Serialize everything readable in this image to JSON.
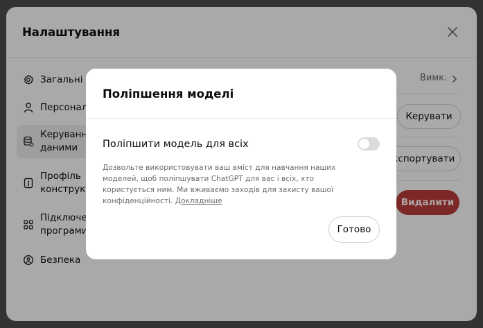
{
  "settings": {
    "title": "Налаштування",
    "nav": [
      {
        "label": "Загальні",
        "icon": "gear-icon"
      },
      {
        "label": "Персоналізація",
        "icon": "person-icon"
      },
      {
        "label": "Керування\nданими",
        "icon": "database-icon",
        "active": true
      },
      {
        "label": "Профіль\nконструктора",
        "icon": "id-card-icon"
      },
      {
        "label": "Підключені\nпрограми",
        "icon": "grid-icon"
      },
      {
        "label": "Безпека",
        "icon": "shield-icon"
      }
    ],
    "row_value": "Вимк.",
    "manage_label": "Керувати",
    "export_label": "Експортувати",
    "delete_label": "Видалити"
  },
  "modal": {
    "title": "Поліпшення моделі",
    "option_label": "Поліпшити модель для всіх",
    "toggle_on": false,
    "description": "Дозвольте використовувати ваш вміст для навчання наших моделей, щоб поліпшувати ChatGPT для вас і всіх, хто користується ним. Ми вживаємо заходів для захисту вашої конфіденційності.",
    "learn_more": "Докладніше",
    "done_label": "Готово"
  },
  "colors": {
    "danger": "#b23a3a",
    "dim": "rgba(0,0,0,0.30)"
  }
}
